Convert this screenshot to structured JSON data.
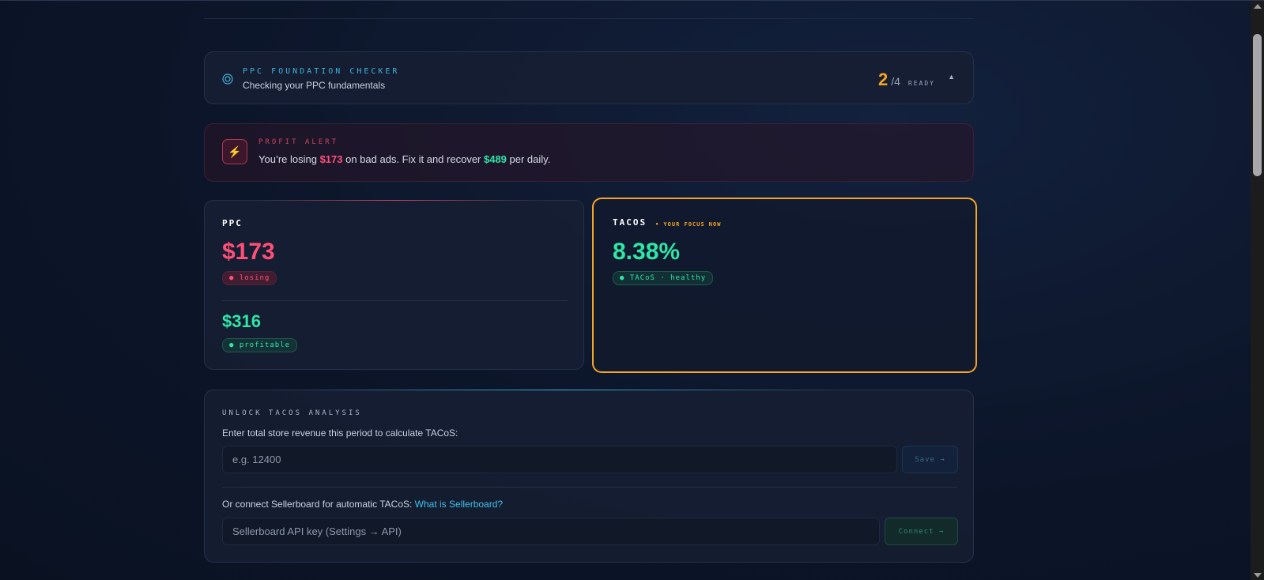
{
  "checker": {
    "title": "PPC FOUNDATION CHECKER",
    "subtitle": "Checking your PPC fundamentals",
    "ready_count": "2",
    "ready_total": "/4",
    "ready_label": "READY",
    "toggle_icon": "chevron-up-icon",
    "toggle_glyph": "▲"
  },
  "alert": {
    "title": "PROFIT ALERT",
    "icon": "bolt-icon",
    "icon_glyph": "⚡",
    "msg_prefix": "You’re losing ",
    "loss": "$173",
    "msg_middle": " on bad ads. Fix it and recover ",
    "recover": "$489",
    "msg_suffix": " per daily."
  },
  "ppc": {
    "label": "PPC",
    "losing_value": "$173",
    "losing_label": "● losing",
    "profitable_value": "$316",
    "profitable_label": "● profitable"
  },
  "tacos": {
    "label": "TACOS",
    "focus": "• YOUR FOCUS NOW",
    "value": "8.38%",
    "status": "● TACoS · healthy"
  },
  "unlock": {
    "title": "UNLOCK TACOS ANALYSIS",
    "prompt": "Enter total store revenue this period to calculate TACoS:",
    "revenue_placeholder": "e.g. 12400",
    "save_label": "Save →",
    "connect_prompt": "Or connect Sellerboard for automatic TACoS: ",
    "connect_link": "What is Sellerboard?",
    "api_placeholder": "Sellerboard API key (Settings → API)",
    "connect_label": "Connect →"
  },
  "colors": {
    "accent_orange": "#f5a524",
    "loss_red": "#ff4f79",
    "profit_green": "#2ee6a6",
    "link_blue": "#3fc0ea"
  }
}
